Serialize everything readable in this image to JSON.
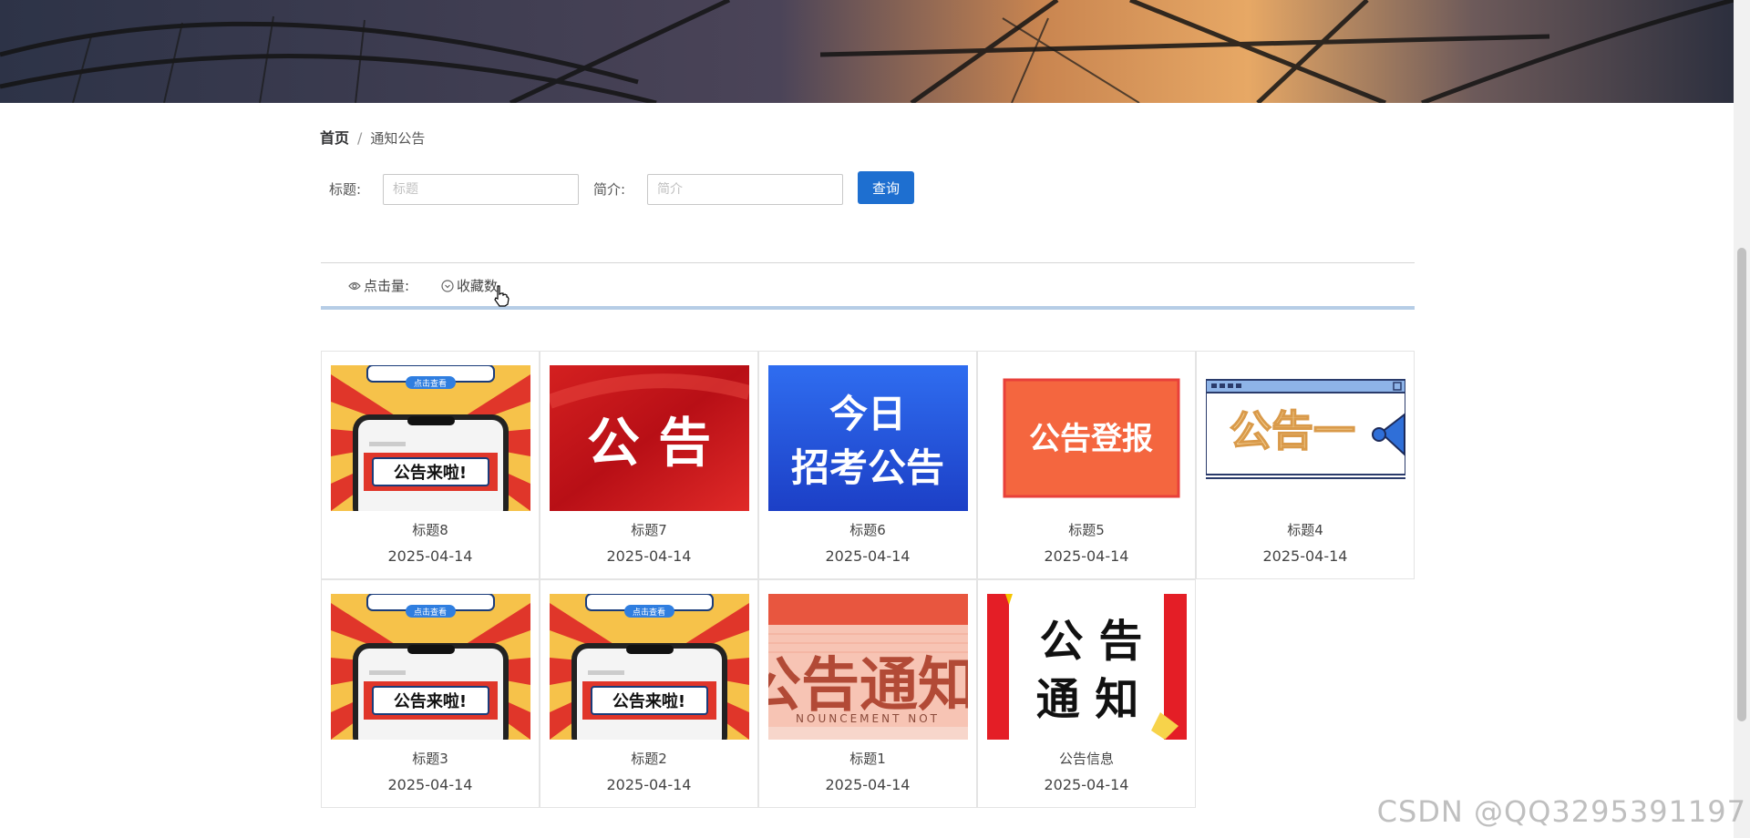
{
  "breadcrumb": {
    "home": "首页",
    "separator": "/",
    "current": "通知公告"
  },
  "search": {
    "title_label": "标题:",
    "title_placeholder": "标题",
    "title_value": "",
    "intro_label": "简介:",
    "intro_placeholder": "简介",
    "intro_value": "",
    "query_button": "查询"
  },
  "sort": {
    "clicks_label": "点击量:",
    "favorites_label": "收藏数"
  },
  "cards": [
    {
      "title": "标题8",
      "date": "2025-04-14",
      "image": "phone-announcement",
      "image_text": "公告来啦!",
      "image_subtext": "点击查看"
    },
    {
      "title": "标题7",
      "date": "2025-04-14",
      "image": "red-announcement",
      "image_text": "公 告"
    },
    {
      "title": "标题6",
      "date": "2025-04-14",
      "image": "blue-exam-announcement",
      "image_text": "今日",
      "image_text2": "招考公告"
    },
    {
      "title": "标题5",
      "date": "2025-04-14",
      "image": "orange-announcement",
      "image_text": "公告登报"
    },
    {
      "title": "标题4",
      "date": "2025-04-14",
      "image": "window-announcement",
      "image_text": "公告一"
    },
    {
      "title": "标题3",
      "date": "2025-04-14",
      "image": "phone-announcement",
      "image_text": "公告来啦!",
      "image_subtext": "点击查看"
    },
    {
      "title": "标题2",
      "date": "2025-04-14",
      "image": "phone-announcement",
      "image_text": "公告来啦!",
      "image_subtext": "点击查看"
    },
    {
      "title": "标题1",
      "date": "2025-04-14",
      "image": "pink-announcement-notice",
      "image_text": "公告通知",
      "image_subtext": "NOUNCEMENT NOT"
    },
    {
      "title": "公告信息",
      "date": "2025-04-14",
      "image": "bw-announcement-notice",
      "image_text": "公 告",
      "image_text2": "通 知"
    }
  ],
  "watermark": "CSDN @QQ3295391197",
  "colors": {
    "primary": "#1e6fd0",
    "sort_underline": "#b6cde6"
  }
}
